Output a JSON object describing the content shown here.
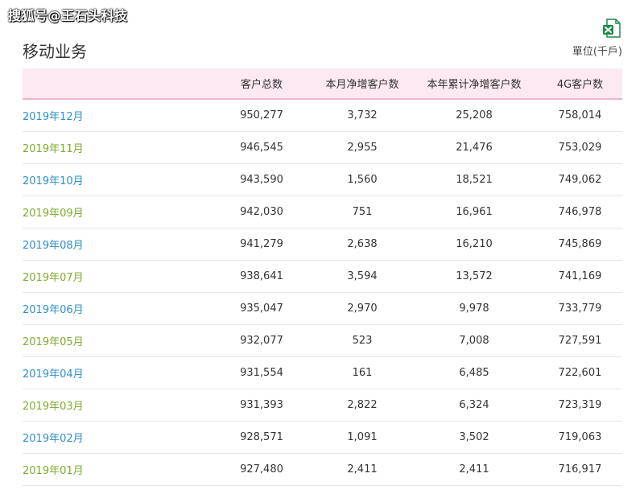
{
  "watermark": "搜狐号@王石头科技",
  "section_title": "移动业务",
  "unit_label": "單位(千戶)",
  "excel_icon": "excel-export-icon",
  "colors": {
    "month_blue": "#2f8fc9",
    "month_green": "#7cab2e",
    "header_bg": "#fce9f1",
    "header_border": "#e9b5ca",
    "excel_green": "#1e8a4a"
  },
  "table": {
    "headers": [
      "",
      "客户总数",
      "本月净增客户数",
      "本年累计净增客户数",
      "4G客户数"
    ],
    "rows": [
      {
        "month": "2019年12月",
        "total": "950,277",
        "net": "3,732",
        "ytd": "25,208",
        "g4": "758,014",
        "color": "#2f8fc9"
      },
      {
        "month": "2019年11月",
        "total": "946,545",
        "net": "2,955",
        "ytd": "21,476",
        "g4": "753,029",
        "color": "#7cab2e"
      },
      {
        "month": "2019年10月",
        "total": "943,590",
        "net": "1,560",
        "ytd": "18,521",
        "g4": "749,062",
        "color": "#2f8fc9"
      },
      {
        "month": "2019年09月",
        "total": "942,030",
        "net": "751",
        "ytd": "16,961",
        "g4": "746,978",
        "color": "#7cab2e"
      },
      {
        "month": "2019年08月",
        "total": "941,279",
        "net": "2,638",
        "ytd": "16,210",
        "g4": "745,869",
        "color": "#2f8fc9"
      },
      {
        "month": "2019年07月",
        "total": "938,641",
        "net": "3,594",
        "ytd": "13,572",
        "g4": "741,169",
        "color": "#7cab2e"
      },
      {
        "month": "2019年06月",
        "total": "935,047",
        "net": "2,970",
        "ytd": "9,978",
        "g4": "733,779",
        "color": "#2f8fc9"
      },
      {
        "month": "2019年05月",
        "total": "932,077",
        "net": "523",
        "ytd": "7,008",
        "g4": "727,591",
        "color": "#7cab2e"
      },
      {
        "month": "2019年04月",
        "total": "931,554",
        "net": "161",
        "ytd": "6,485",
        "g4": "722,601",
        "color": "#2f8fc9"
      },
      {
        "month": "2019年03月",
        "total": "931,393",
        "net": "2,822",
        "ytd": "6,324",
        "g4": "723,319",
        "color": "#7cab2e"
      },
      {
        "month": "2019年02月",
        "total": "928,571",
        "net": "1,091",
        "ytd": "3,502",
        "g4": "719,063",
        "color": "#2f8fc9"
      },
      {
        "month": "2019年01月",
        "total": "927,480",
        "net": "2,411",
        "ytd": "2,411",
        "g4": "716,917",
        "color": "#7cab2e"
      }
    ]
  }
}
